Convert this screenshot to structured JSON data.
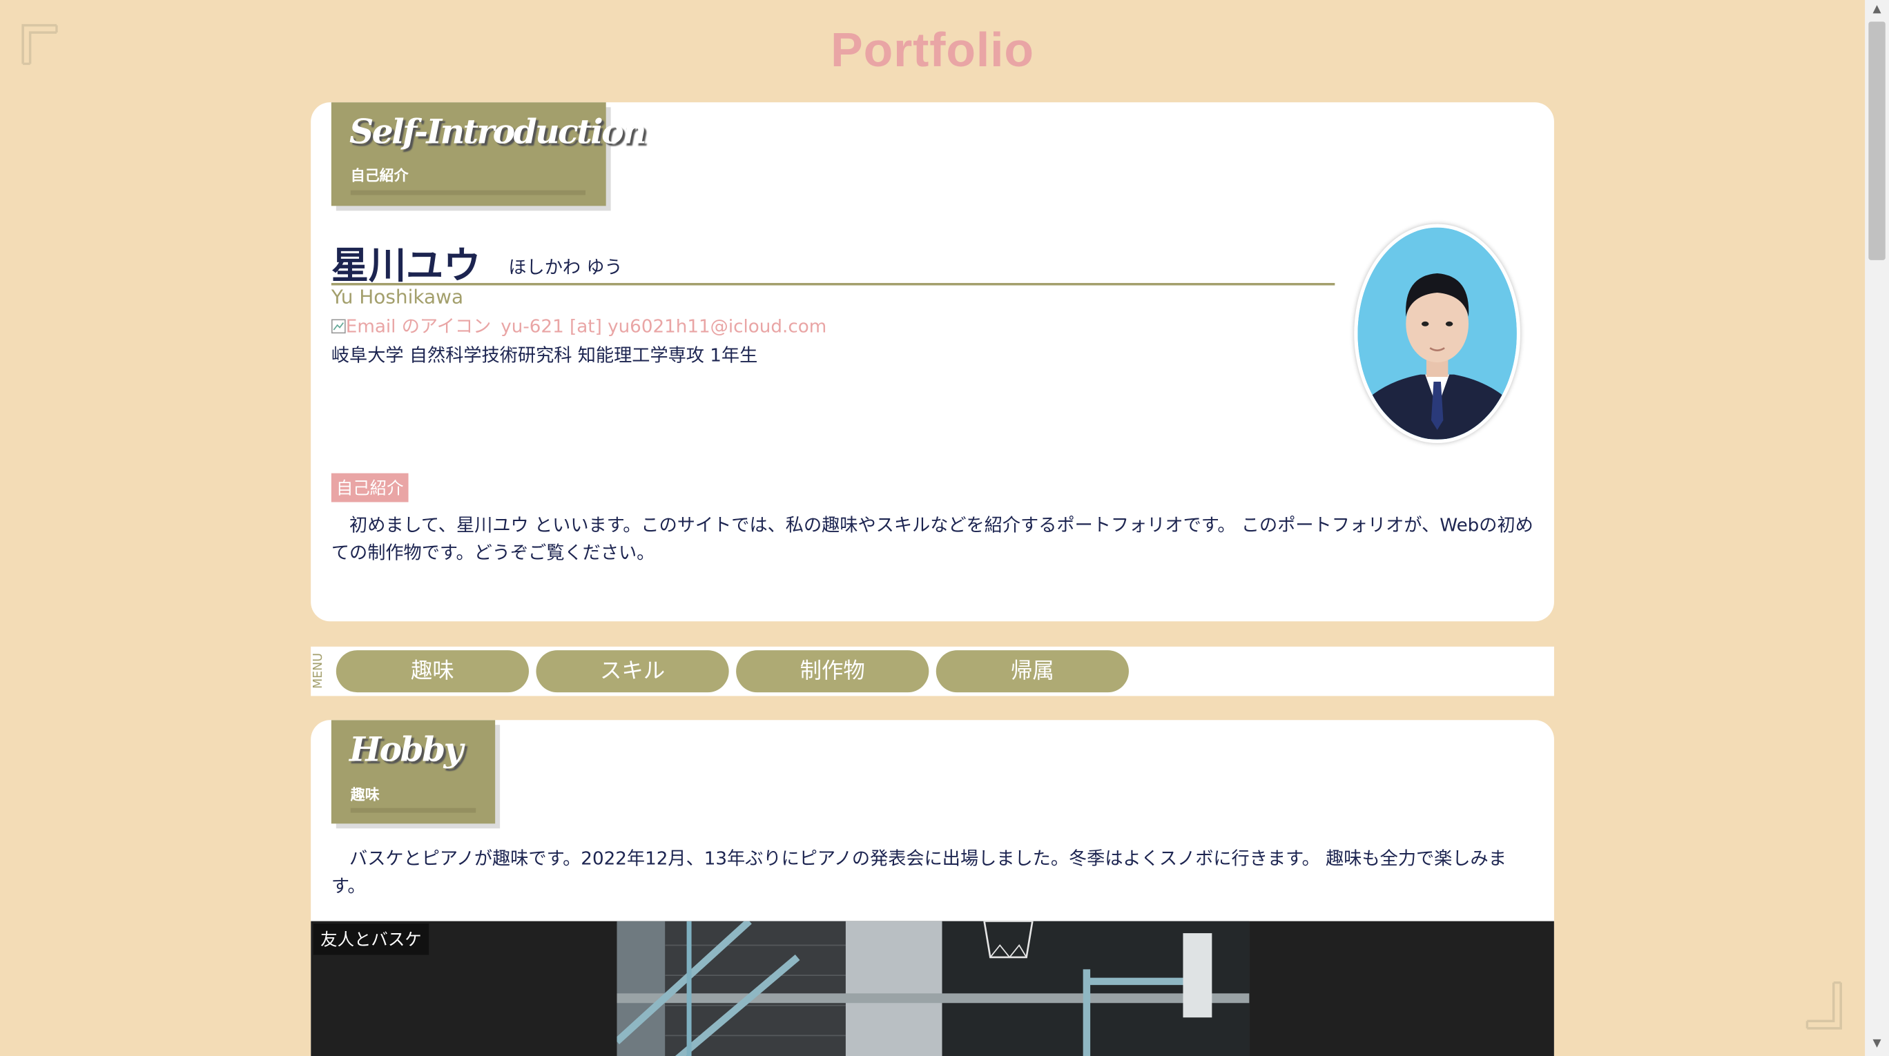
{
  "site": {
    "title": "Portfolio"
  },
  "intro_section": {
    "heading_en": "Self-Introduction",
    "heading_jp": "自己紹介",
    "name": "星川ユウ",
    "name_kana": "ほしかわ ゆう",
    "name_en": "Yu Hoshikawa",
    "email_icon_alt": "Email のアイコン",
    "email_text": "yu-621 [at] yu6021h11@icloud.com",
    "affiliation": "岐阜大学 自然科学技術研究科 知能理工学専攻 1年生",
    "tag": "自己紹介",
    "body": "　初めまして、星川ユウ といいます。このサイトでは、私の趣味やスキルなどを紹介するポートフォリオです。 このポートフォリオが、Webの初めての制作物です。どうぞご覧ください。"
  },
  "menu": {
    "label": "MENU",
    "items": [
      "趣味",
      "スキル",
      "制作物",
      "帰属"
    ]
  },
  "hobby_section": {
    "heading_en": "Hobby",
    "heading_jp": "趣味",
    "body": "　バスケとピアノが趣味です。2022年12月、13年ぶりにピアノの発表会に出場しました。冬季はよくスノボに行きます。 趣味も全力で楽しみます。",
    "gallery_caption": "友人とバスケ"
  },
  "colors": {
    "background": "#f3dcb6",
    "title_pink": "#e9a5a5",
    "olive": "#a39f6c",
    "text_navy": "#1c2450"
  }
}
